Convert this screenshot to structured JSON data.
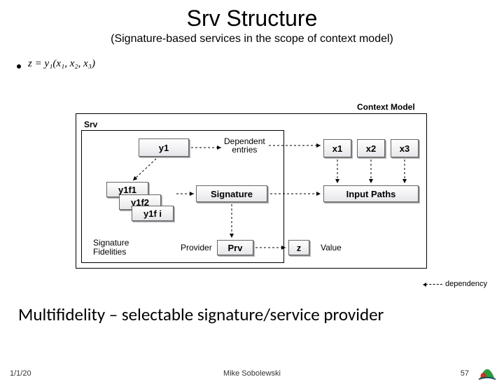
{
  "title": "Srv Structure",
  "subtitle": "(Signature-based services in the scope of context model)",
  "formula": "z = y₁(x₁, x₂, x₃)",
  "labels": {
    "contextModel": "Context Model",
    "srv": "Srv",
    "dependent": "Dependent\nentries",
    "sigFidelities": "Signature\nFidelities",
    "provider": "Provider",
    "value": "Value",
    "dependency": "dependency"
  },
  "nodes": {
    "y1": "y1",
    "x1": "x1",
    "x2": "x2",
    "x3": "x3",
    "f1": "y1f1",
    "f2": "y1f2",
    "fi": "y1f i",
    "signature": "Signature",
    "inputPaths": "Input Paths",
    "prv": "Prv",
    "z": "z"
  },
  "tagline": "Multifidelity – selectable signature/service provider",
  "footer": {
    "date": "1/1/20",
    "author": "Mike Sobolewski",
    "page": "57"
  }
}
